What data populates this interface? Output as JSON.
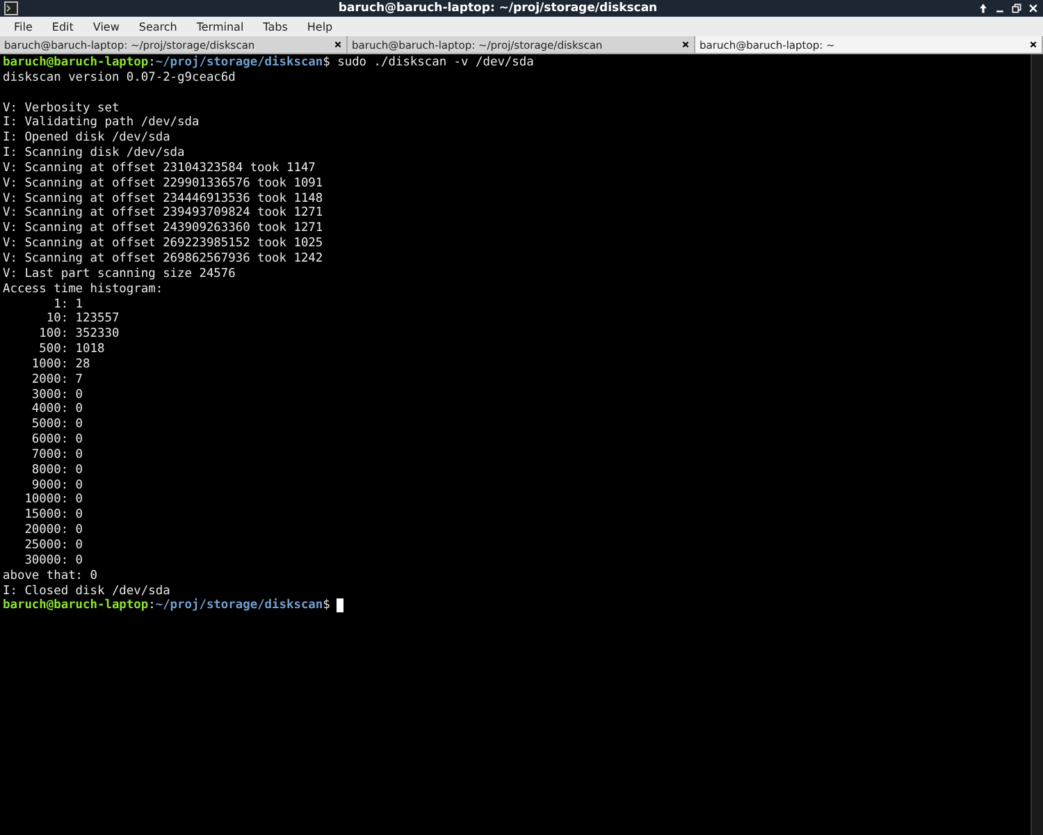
{
  "window": {
    "title": "baruch@baruch-laptop: ~/proj/storage/diskscan"
  },
  "menu": [
    "File",
    "Edit",
    "View",
    "Search",
    "Terminal",
    "Tabs",
    "Help"
  ],
  "tabs": [
    {
      "label": "baruch@baruch-laptop: ~/proj/storage/diskscan",
      "selected": false
    },
    {
      "label": "baruch@baruch-laptop: ~/proj/storage/diskscan",
      "selected": false
    },
    {
      "label": "baruch@baruch-laptop: ~",
      "selected": true
    }
  ],
  "terminal": {
    "lines": [
      {
        "kind": "prompt",
        "user_host": "baruch@baruch-laptop",
        "separator": ":",
        "path": "~/proj/storage/diskscan",
        "sign": "$",
        "command": "sudo ./diskscan -v /dev/sda"
      },
      {
        "kind": "output",
        "text": "diskscan version 0.07-2-g9ceac6d"
      },
      {
        "kind": "blank"
      },
      {
        "kind": "output",
        "text": "V: Verbosity set"
      },
      {
        "kind": "output",
        "text": "I: Validating path /dev/sda"
      },
      {
        "kind": "output",
        "text": "I: Opened disk /dev/sda"
      },
      {
        "kind": "output",
        "text": "I: Scanning disk /dev/sda"
      },
      {
        "kind": "output",
        "text": "V: Scanning at offset 23104323584 took 1147"
      },
      {
        "kind": "output",
        "text": "V: Scanning at offset 229901336576 took 1091"
      },
      {
        "kind": "output",
        "text": "V: Scanning at offset 234446913536 took 1148"
      },
      {
        "kind": "output",
        "text": "V: Scanning at offset 239493709824 took 1271"
      },
      {
        "kind": "output",
        "text": "V: Scanning at offset 243909263360 took 1271"
      },
      {
        "kind": "output",
        "text": "V: Scanning at offset 269223985152 took 1025"
      },
      {
        "kind": "output",
        "text": "V: Scanning at offset 269862567936 took 1242"
      },
      {
        "kind": "output",
        "text": "V: Last part scanning size 24576"
      },
      {
        "kind": "output",
        "text": "Access time histogram:"
      },
      {
        "kind": "output",
        "text": "       1: 1"
      },
      {
        "kind": "output",
        "text": "      10: 123557"
      },
      {
        "kind": "output",
        "text": "     100: 352330"
      },
      {
        "kind": "output",
        "text": "     500: 1018"
      },
      {
        "kind": "output",
        "text": "    1000: 28"
      },
      {
        "kind": "output",
        "text": "    2000: 7"
      },
      {
        "kind": "output",
        "text": "    3000: 0"
      },
      {
        "kind": "output",
        "text": "    4000: 0"
      },
      {
        "kind": "output",
        "text": "    5000: 0"
      },
      {
        "kind": "output",
        "text": "    6000: 0"
      },
      {
        "kind": "output",
        "text": "    7000: 0"
      },
      {
        "kind": "output",
        "text": "    8000: 0"
      },
      {
        "kind": "output",
        "text": "    9000: 0"
      },
      {
        "kind": "output",
        "text": "   10000: 0"
      },
      {
        "kind": "output",
        "text": "   15000: 0"
      },
      {
        "kind": "output",
        "text": "   20000: 0"
      },
      {
        "kind": "output",
        "text": "   25000: 0"
      },
      {
        "kind": "output",
        "text": "   30000: 0"
      },
      {
        "kind": "output",
        "text": "above that: 0"
      },
      {
        "kind": "output",
        "text": "I: Closed disk /dev/sda"
      },
      {
        "kind": "prompt",
        "user_host": "baruch@baruch-laptop",
        "separator": ":",
        "path": "~/proj/storage/diskscan",
        "sign": "$",
        "cursor": true
      }
    ]
  }
}
